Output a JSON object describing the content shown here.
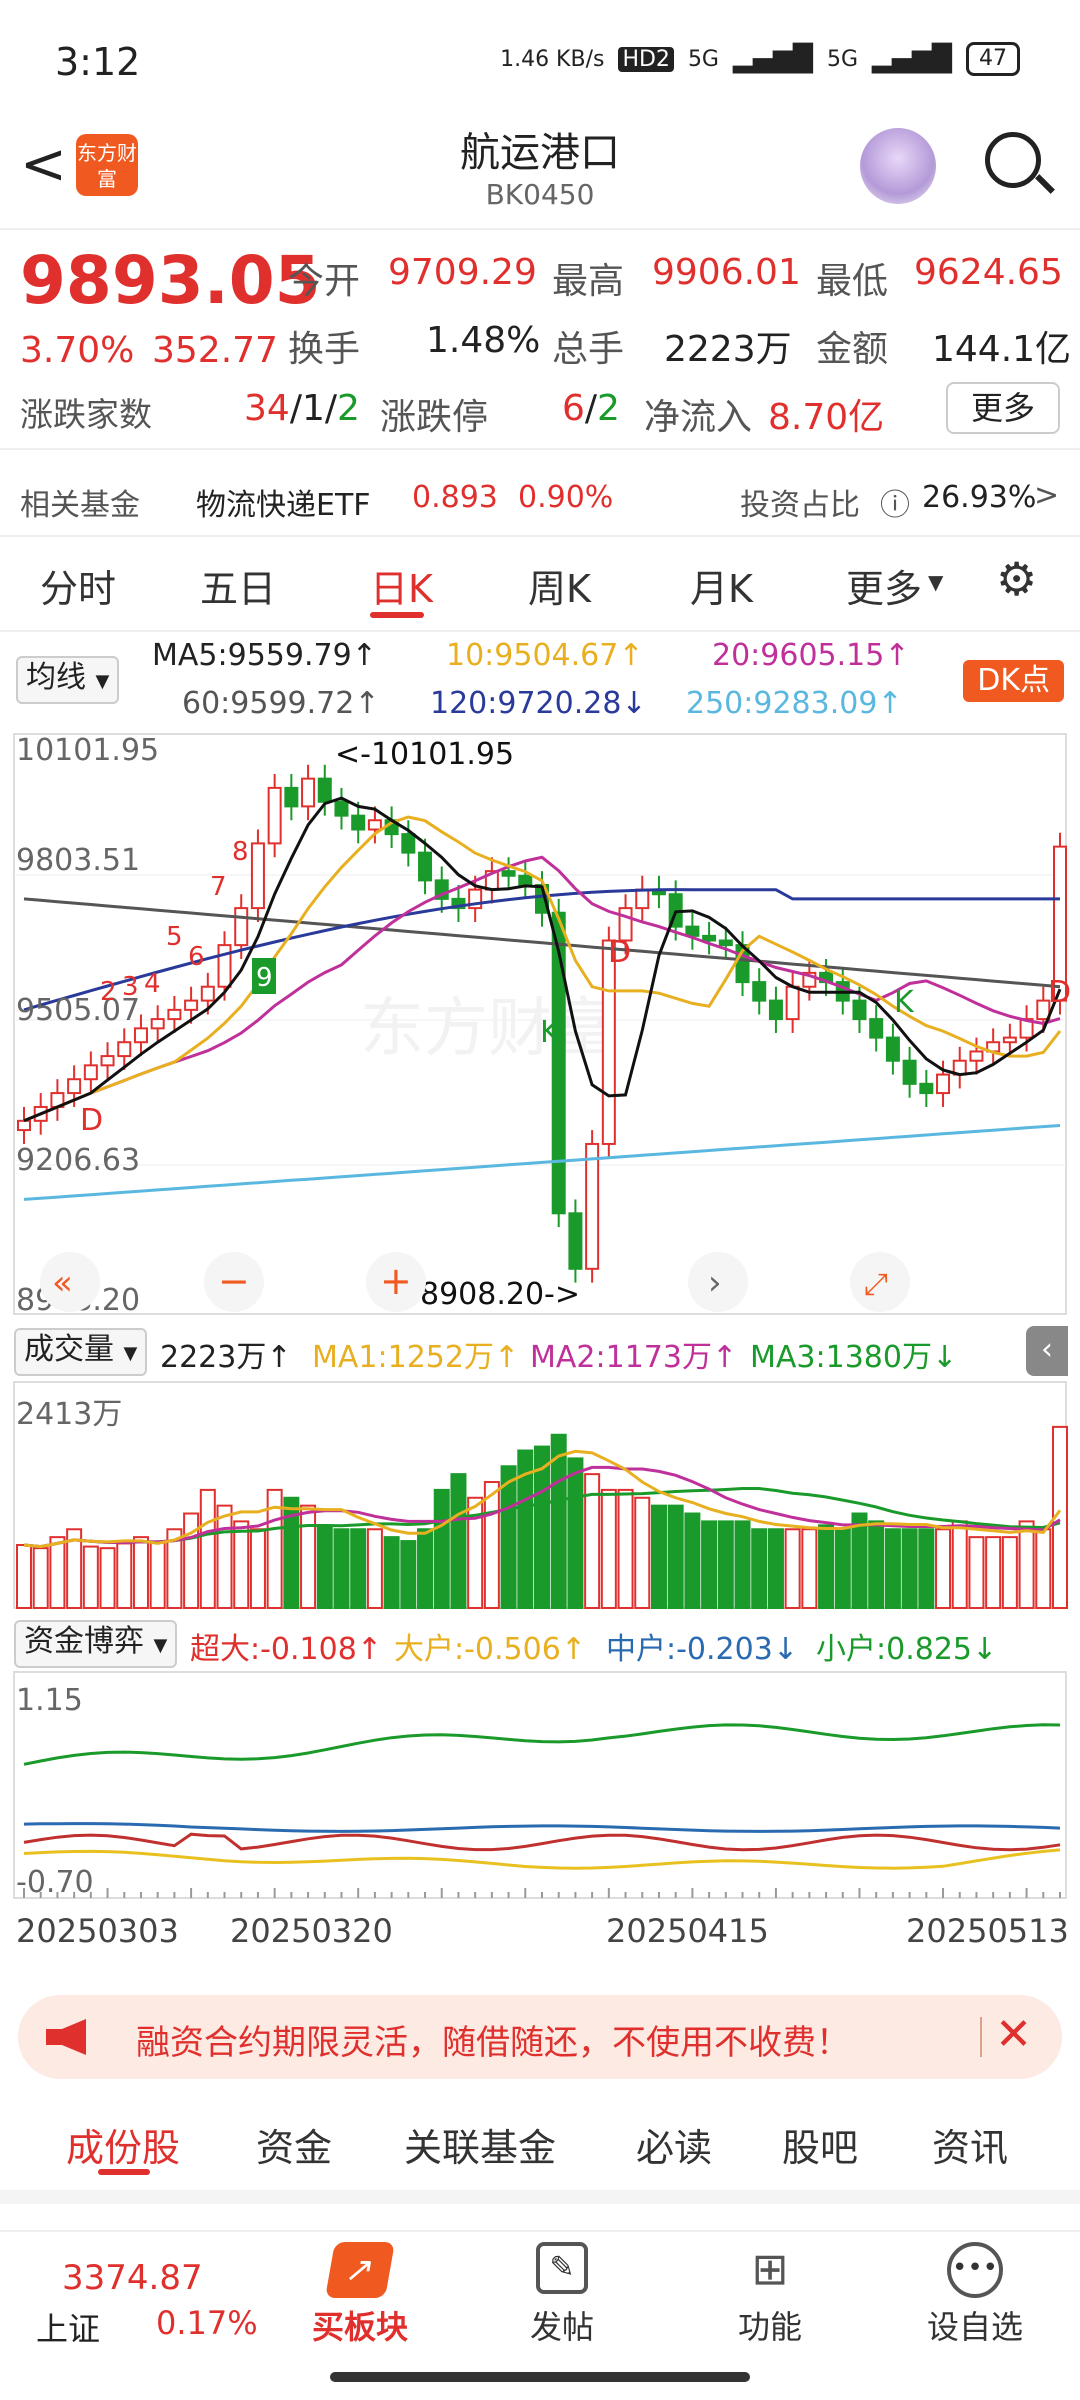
{
  "status": {
    "time": "3:12",
    "speed": "1.46 KB/s",
    "hd": "HD2",
    "net1": "5G",
    "net2": "5G",
    "battery": "47"
  },
  "header": {
    "back": "<",
    "logo": "东方财富",
    "title": "航运港口",
    "code": "BK0450"
  },
  "quote": {
    "price": "9893.05",
    "pct": "3.70%",
    "chg": "352.77",
    "open_label": "今开",
    "open": "9709.29",
    "high_label": "最高",
    "high": "9906.01",
    "low_label": "最低",
    "low": "9624.65",
    "turnover_label": "换手",
    "turnover": "1.48%",
    "vol_label": "总手",
    "vol": "2223万",
    "amount_label": "金额",
    "amount": "144.1亿",
    "updown_label": "涨跌家数",
    "up": "34",
    "flat": "1",
    "down": "2",
    "limit_label": "涨跌停",
    "limit_up": "6",
    "limit_down": "2",
    "inflow_label": "净流入",
    "inflow": "8.70亿",
    "more": "更多"
  },
  "fund": {
    "label": "相关基金",
    "name": "物流快递ETF",
    "price": "0.893",
    "pct": "0.90%",
    "ratio_label": "投资占比",
    "ratio": "26.93%"
  },
  "tabs": [
    "分时",
    "五日",
    "日K",
    "周K",
    "月K",
    "更多"
  ],
  "ma": {
    "selector": "均线",
    "ma5": "MA5:9559.79↑",
    "ma10": "10:9504.67↑",
    "ma20": "20:9605.15↑",
    "ma60": "60:9599.72↑",
    "ma120": "120:9720.28↓",
    "ma250": "250:9283.09↑",
    "dk": "DK点"
  },
  "kline": {
    "y_labels": [
      "10101.95",
      "9803.51",
      "9505.07",
      "9206.63",
      "8908.20"
    ],
    "max_note": "<-10101.95",
    "min_note": "8908.20->",
    "markers": [
      "2",
      "3",
      "4",
      "5",
      "6",
      "7",
      "8",
      "9",
      "D",
      "K",
      "D",
      "K",
      "D"
    ]
  },
  "volume": {
    "selector": "成交量",
    "cur": "2223万↑",
    "ma1": "MA1:1252万↑",
    "ma2": "MA2:1173万↑",
    "ma3": "MA3:1380万↓",
    "y_label": "2413万"
  },
  "capital": {
    "selector": "资金博弈",
    "super": "超大:-0.108↑",
    "big": "大户:-0.506↑",
    "mid": "中户:-0.203↓",
    "small": "小户:0.825↓",
    "y_top": "1.15",
    "y_bottom": "-0.70"
  },
  "dates": [
    "20250303",
    "20250320",
    "20250415",
    "20250513"
  ],
  "banner": {
    "text": "融资合约期限灵活，随借随还，不使用不收费！"
  },
  "btabs": [
    "成份股",
    "资金",
    "关联基金",
    "必读",
    "股吧",
    "资讯"
  ],
  "bottom": {
    "index_val": "3374.87",
    "index_name": "上证",
    "index_pct": "0.17%",
    "buy": "买板块",
    "post": "发帖",
    "func": "功能",
    "fav": "设自选"
  },
  "colors": {
    "up": "#e0302e",
    "down": "#1a9a2a",
    "accent": "#f05a21"
  }
}
